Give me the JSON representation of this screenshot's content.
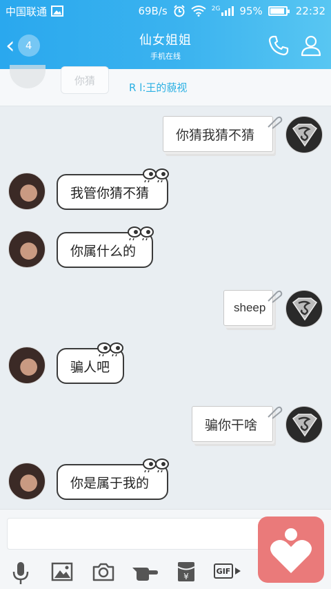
{
  "status_bar": {
    "carrier": "中国联通",
    "speed": "69B/s",
    "network": "2G",
    "battery": "95%",
    "time": "22:32"
  },
  "header": {
    "back_count": "4",
    "title": "仙女姐姐",
    "subtitle": "手机在线"
  },
  "pinned": {
    "peek_bubble": "你猜",
    "text": "R l:王的藐视"
  },
  "messages": [
    {
      "side": "right",
      "text": "你猜我猜不猜"
    },
    {
      "side": "left",
      "text": "我管你猜不猜"
    },
    {
      "side": "left",
      "text": "你属什么的"
    },
    {
      "side": "right",
      "text": "sheep"
    },
    {
      "side": "left",
      "text": "骗人吧"
    },
    {
      "side": "right",
      "text": "骗你干啥"
    },
    {
      "side": "left",
      "text": "你是属于我的"
    }
  ],
  "input": {
    "value": ""
  },
  "toolbar": {
    "icons": [
      "microphone-icon",
      "image-icon",
      "camera-icon",
      "hand-icon",
      "red-packet-icon",
      "gif-icon"
    ],
    "gif_label": "GIF",
    "red_packet_symbol": "¥"
  },
  "colors": {
    "header": "#2aa8ee",
    "chat_background": "#e9eef2",
    "accent_link": "#2bb0e3",
    "heart_button": "#ea7a7a"
  }
}
